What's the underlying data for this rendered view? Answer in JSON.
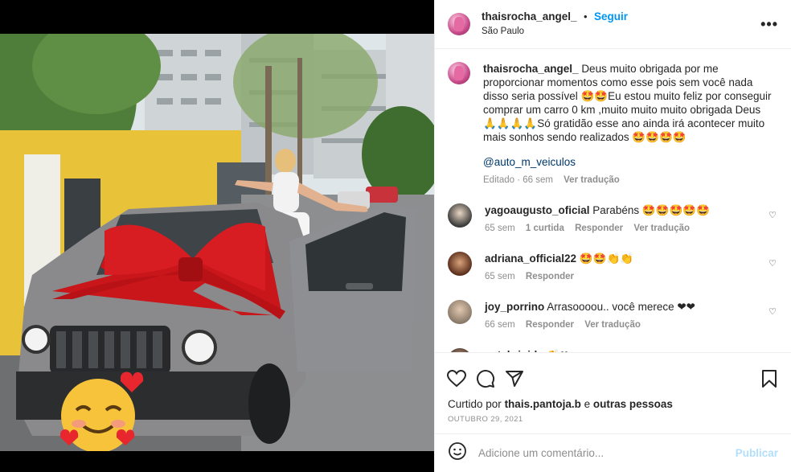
{
  "post": {
    "username": "thaisrocha_angel_",
    "follow_label": "Seguir",
    "location": "São Paulo",
    "more_label": "•••"
  },
  "caption": {
    "username": "thaisrocha_angel_",
    "text": "Deus muito obrigada por me proporcionar momentos como esse pois sem você nada disso seria possível 🤩🤩Eu estou muito feliz por conseguir comprar um carro 0 km ,muito muito muito obrigada Deus 🙏🙏🙏🙏Só gratidão esse ano ainda irá acontecer muito mais sonhos sendo realizados 🤩🤩🤩🤩",
    "mention": "@auto_m_veiculos",
    "edited": "Editado · 66 sem",
    "translate": "Ver tradução"
  },
  "comments": [
    {
      "username": "yagoaugusto_oficial",
      "text": "Parabéns 🤩🤩🤩🤩🤩",
      "time": "65 sem",
      "likes": "1 curtida",
      "reply": "Responder",
      "translate": "Ver tradução"
    },
    {
      "username": "adriana_official22",
      "text": "🤩🤩👏👏",
      "time": "65 sem",
      "reply": "Responder"
    },
    {
      "username": "joy_porrino",
      "text": "Arrasoooou.. você merece ❤❤",
      "time": "66 sem",
      "reply": "Responder",
      "translate": "Ver tradução"
    },
    {
      "username": "pat_brigida",
      "text": "👏❤"
    }
  ],
  "likes": {
    "prefix": "Curtido por",
    "user": "thais.pantoja.b",
    "conj": "e",
    "others": "outras pessoas"
  },
  "date": "OUTUBRO 29, 2021",
  "add_comment": {
    "placeholder": "Adicione um comentário...",
    "publish_label": "Publicar"
  },
  "icons": [
    "heart-icon",
    "comment-icon",
    "share-icon",
    "bookmark-icon",
    "emoji-icon"
  ],
  "colors": {
    "link": "#0095f6",
    "mention": "#00376b",
    "muted": "#8e8e8e",
    "car": "#8a8a8c",
    "bow": "#d01818"
  }
}
